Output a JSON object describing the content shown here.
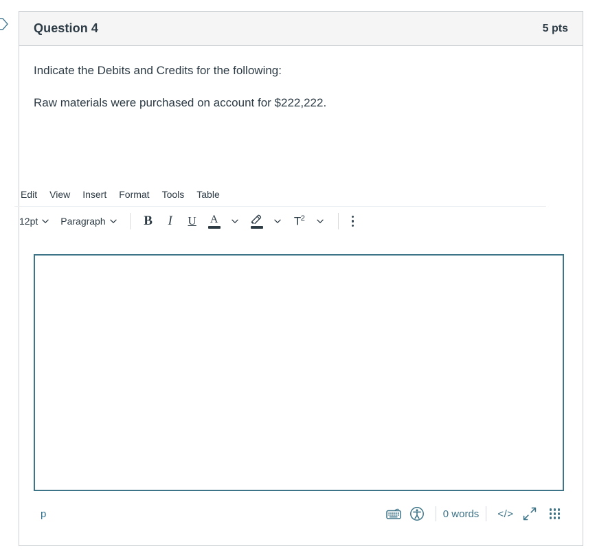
{
  "marker": {
    "icon": "arrow-pointer-marker"
  },
  "question": {
    "title": "Question 4",
    "points": "5 pts",
    "paragraphs": [
      "Indicate the Debits and Credits for the following:",
      "Raw materials were purchased on account for $222,222."
    ]
  },
  "editor": {
    "menubar": [
      {
        "label": "Edit",
        "name": "menu-edit"
      },
      {
        "label": "View",
        "name": "menu-view"
      },
      {
        "label": "Insert",
        "name": "menu-insert"
      },
      {
        "label": "Format",
        "name": "menu-format"
      },
      {
        "label": "Tools",
        "name": "menu-tools"
      },
      {
        "label": "Table",
        "name": "menu-table"
      }
    ],
    "toolbar": {
      "font_size": "12pt",
      "block_format": "Paragraph",
      "bold_label": "B",
      "italic_label": "I",
      "underline_label": "U",
      "text_color_label": "A",
      "superscript_label": "T",
      "superscript_exponent": "2",
      "icons": {
        "chevron": "chevron-down-icon",
        "highlight": "highlighter-pen-icon",
        "more": "more-options-kebab-icon"
      }
    },
    "content": {
      "value": "",
      "placeholder": ""
    },
    "status": {
      "element_path": "p",
      "word_count": "0 words",
      "code_label": "</>",
      "icons": {
        "keyboard": "keyboard-shortcuts-icon",
        "accessibility": "accessibility-checker-icon",
        "fullscreen": "fullscreen-expand-icon",
        "resize": "resize-grip-icon"
      }
    }
  },
  "colors": {
    "header_bg": "#f5f5f5",
    "card_border": "#c7cdd1",
    "text": "#2d3b45",
    "editor_focus_border": "#3d7488",
    "status_accent": "#3d7488"
  }
}
